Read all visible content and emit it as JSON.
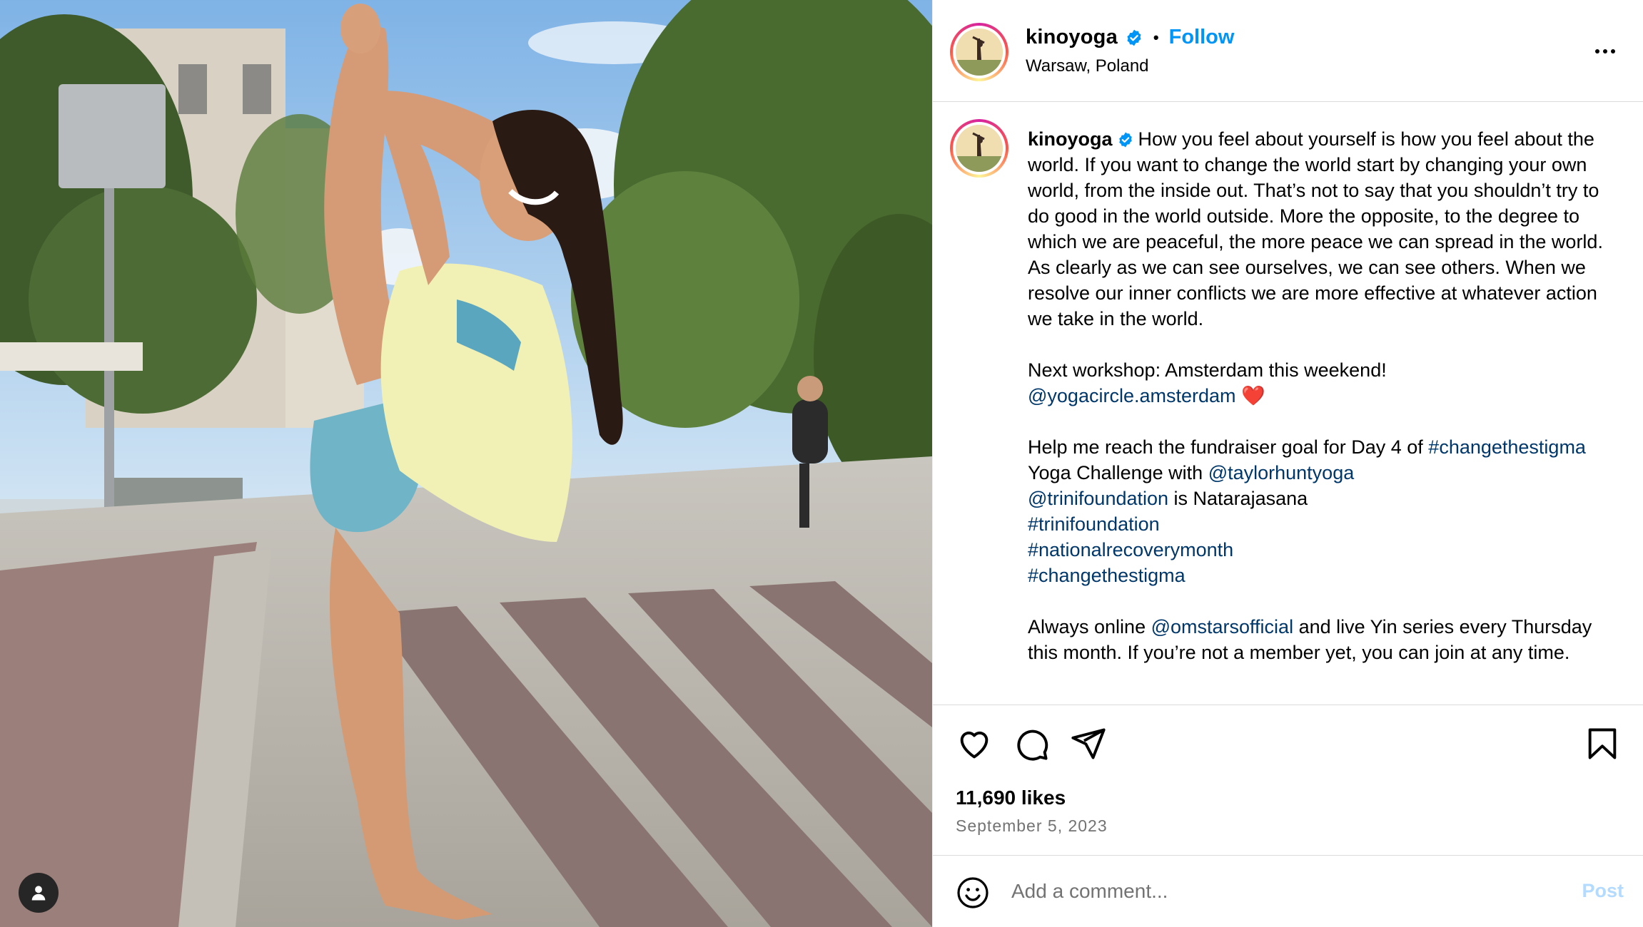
{
  "post": {
    "username": "kinoyoga",
    "location": "Warsaw, Poland",
    "follow_label": "Follow",
    "dot_separator": "•",
    "likes": "11,690 likes",
    "date": "September 5, 2023"
  },
  "caption": {
    "username": "kinoyoga",
    "p1": "How you feel about yourself is how you feel about the world. If you want to change the world start by changing your own world, from the inside out. That’s not to say that you shouldn’t try to do good in the world outside. More the opposite, to the degree to which we are peaceful, the more peace we can spread in the world. As clearly as we can see ourselves, we can see others. When we resolve our inner conflicts we are more effective at whatever action we take in the world.",
    "p2_text": "Next workshop: Amsterdam this weekend!",
    "p2_mention": "@yogacircle.amsterdam",
    "p2_emoji": "❤️",
    "p3_text1": "Help me reach the fundraiser goal for Day 4 of ",
    "p3_tag1": "#changethestigma",
    "p3_text2": " Yoga Challenge with ",
    "p3_mention1": "@taylorhuntyoga",
    "p3_mention2": "@trinifoundation",
    "p3_text3": " is Natarajasana",
    "p3_tag2": "#trinifoundation",
    "p3_tag3": "#nationalrecoverymonth",
    "p3_tag4": "#changethestigma",
    "p4_text1": "Always online ",
    "p4_mention": "@omstarsofficial",
    "p4_text2": " and live Yin series every Thursday this month. If you’re not a member yet, you can join at any time."
  },
  "comment": {
    "placeholder": "Add a comment...",
    "post_label": "Post"
  },
  "icons": {
    "verified": "verified-badge-icon",
    "more": "more-options-icon",
    "like": "heart-icon",
    "comment": "comment-bubble-icon",
    "share": "paper-plane-icon",
    "save": "bookmark-icon",
    "emoji": "smiley-icon",
    "tag": "user-tag-icon"
  },
  "colors": {
    "link": "#00376b",
    "follow": "#0095f6",
    "verified": "#0095f6",
    "post_disabled": "#b3dbff",
    "muted": "#737373"
  }
}
